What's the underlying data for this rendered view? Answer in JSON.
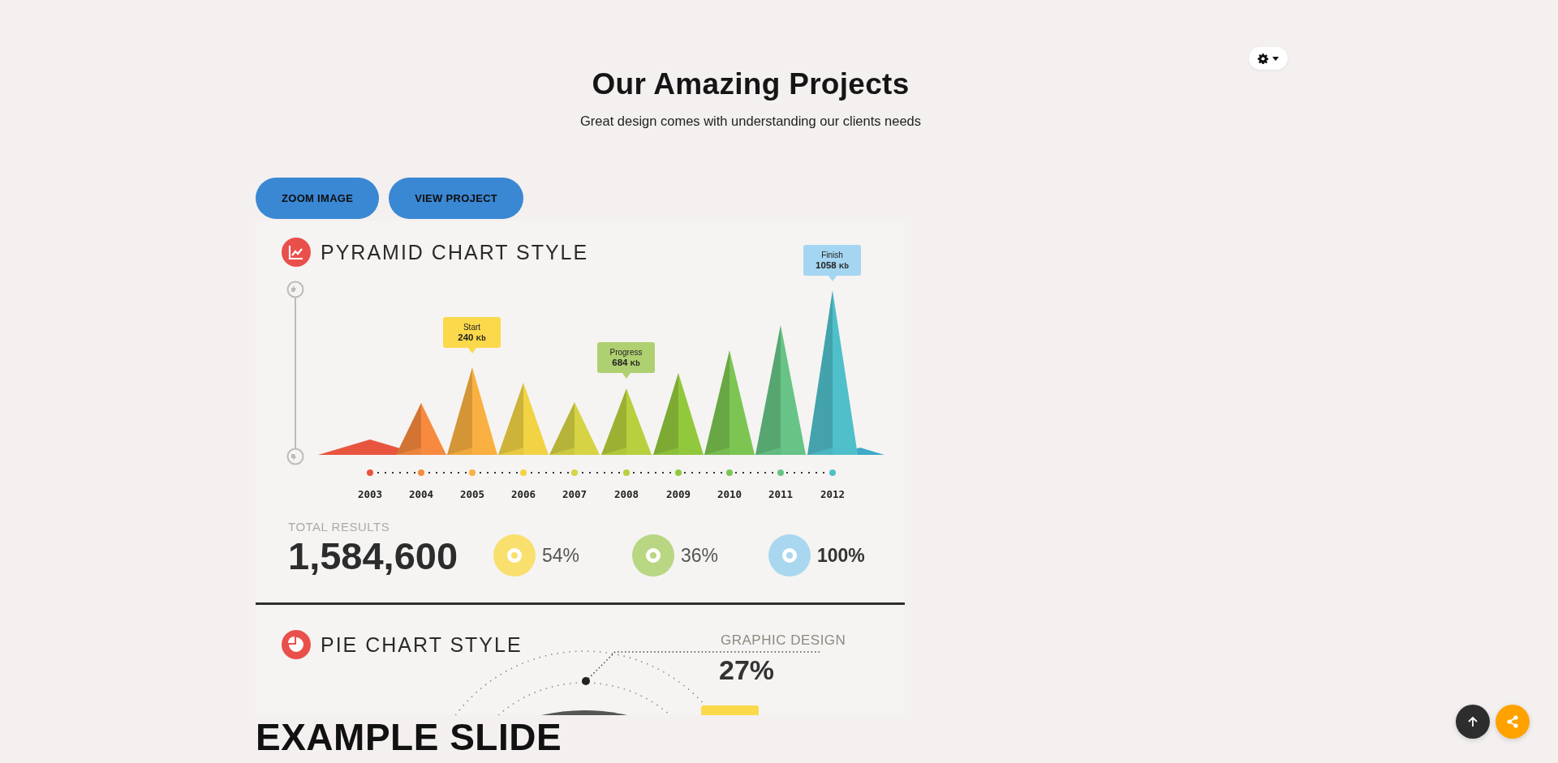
{
  "header": {
    "title": "Our Amazing Projects",
    "subtitle": "Great design comes with understanding our clients needs"
  },
  "actions": [
    {
      "label": "ZOOM IMAGE"
    },
    {
      "label": "VIEW PROJECT"
    }
  ],
  "infographic": {
    "pyramid_section": {
      "title": "PYRAMID CHART STYLE",
      "years": [
        "2003",
        "2004",
        "2005",
        "2006",
        "2007",
        "2008",
        "2009",
        "2010",
        "2011",
        "2012"
      ],
      "callouts": [
        {
          "label": "Start",
          "value": "240",
          "unit": "Kb",
          "color": "#fbd94a"
        },
        {
          "label": "Progress",
          "value": "684",
          "unit": "Kb",
          "color": "#afd071"
        },
        {
          "label": "Finish",
          "value": "1058",
          "unit": "Kb",
          "color": "#a4d6f1"
        }
      ]
    },
    "totals": {
      "label": "TOTAL RESULTS",
      "value": "1,584,600",
      "rings": [
        {
          "value": "54%",
          "color": "#f9df6e",
          "emphasis": false
        },
        {
          "value": "36%",
          "color": "#b9d683",
          "emphasis": false
        },
        {
          "value": "100%",
          "color": "#a9d7ef",
          "emphasis": true
        }
      ]
    },
    "pie_section": {
      "title": "PIE CHART STYLE",
      "category": "GRAPHIC DESIGN",
      "value": "27%"
    }
  },
  "heading": "EXAMPLE SLIDE"
}
